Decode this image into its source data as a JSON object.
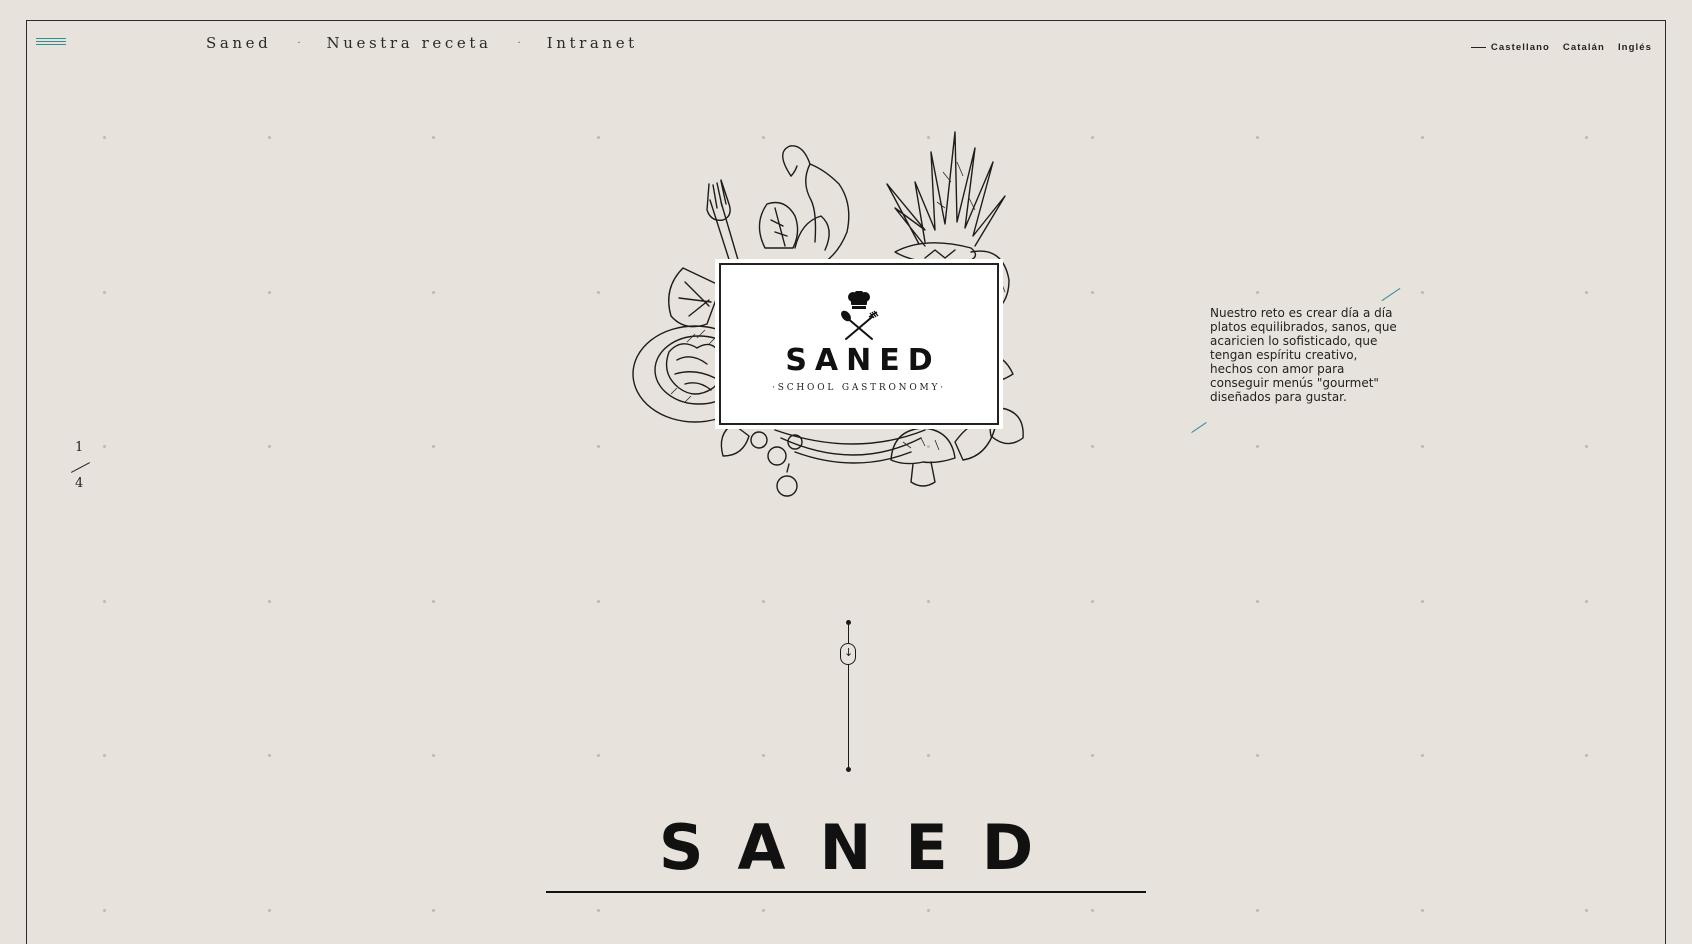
{
  "menu": {
    "icon": "hamburger-icon",
    "accent_color": "#2e8f94"
  },
  "nav": {
    "items": [
      "Saned",
      "Nuestra receta",
      "Intranet"
    ],
    "separator": "·"
  },
  "languages": [
    "Castellano",
    "Catalán",
    "Inglés"
  ],
  "pager": {
    "current": "1",
    "total": "4"
  },
  "logo": {
    "icon": "chef-hat-spoon-fork-icon",
    "name": "SANED",
    "tagline": "·SCHOOL GASTRONOMY·"
  },
  "tagline": "Nuestro reto es crear día a día platos equilibrados, sanos, que acaricien lo sofisticado, que tengan espíritu creativo, hechos con amor para conseguir menús \"gourmet\" diseñados para gustar.",
  "scroll": {
    "icon": "scroll-down-arrow-icon",
    "glyph": "↓"
  },
  "hero_title": "SANED",
  "colors": {
    "background": "#e7e3dc",
    "accent": "#2e8f94",
    "ink": "#111111"
  }
}
